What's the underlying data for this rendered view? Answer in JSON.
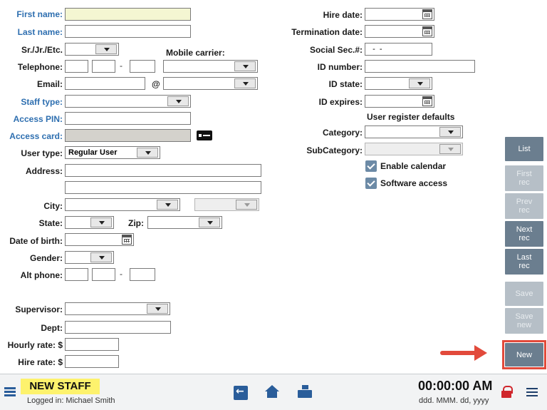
{
  "form": {
    "first_name_label": "First name:",
    "last_name_label": "Last name:",
    "suffix_label": "Sr./Jr./Etc.",
    "mobile_carrier_label": "Mobile carrier:",
    "telephone_label": "Telephone:",
    "phone_dash": "-",
    "email_label": "Email:",
    "email_at": "@",
    "staff_type_label": "Staff type:",
    "access_pin_label": "Access PIN:",
    "access_card_label": "Access card:",
    "user_type_label": "User type:",
    "user_type_value": "Regular User",
    "address_label": "Address:",
    "city_label": "City:",
    "state_label": "State:",
    "zip_label": "Zip:",
    "dob_label": "Date of birth:",
    "gender_label": "Gender:",
    "alt_phone_label": "Alt phone:",
    "supervisor_label": "Supervisor:",
    "dept_label": "Dept:",
    "hourly_rate_label": "Hourly rate: $",
    "hire_rate_label": "Hire rate: $",
    "hire_date_label": "Hire date:",
    "termination_date_label": "Termination date:",
    "ssn_label": "Social Sec.#:",
    "ssn_value": "  -  -",
    "id_number_label": "ID number:",
    "id_state_label": "ID state:",
    "id_expires_label": "ID expires:",
    "register_defaults_title": "User register defaults",
    "category_label": "Category:",
    "subcategory_label": "SubCategory:",
    "enable_calendar_label": "Enable calendar",
    "software_access_label": "Software access"
  },
  "sidebar": {
    "list": "List",
    "first_rec_1": "First",
    "first_rec_2": "rec",
    "prev_rec_1": "Prev",
    "prev_rec_2": "rec",
    "next_rec_1": "Next",
    "next_rec_2": "rec",
    "last_rec_1": "Last",
    "last_rec_2": "rec",
    "save": "Save",
    "save_new_1": "Save",
    "save_new_2": "new",
    "new": "New"
  },
  "footer": {
    "screen_title": "NEW STAFF",
    "logged_in": "Logged in:  Michael Smith",
    "clock": "00:00:00 AM",
    "date_format": "ddd. MMM. dd, yyyy"
  },
  "colors": {
    "label_blue": "#2e6fb0",
    "button": "#6b7e8f",
    "button_disabled": "#b6bfc7",
    "highlight": "#e24a3b",
    "title_badge": "#fdf26d"
  }
}
